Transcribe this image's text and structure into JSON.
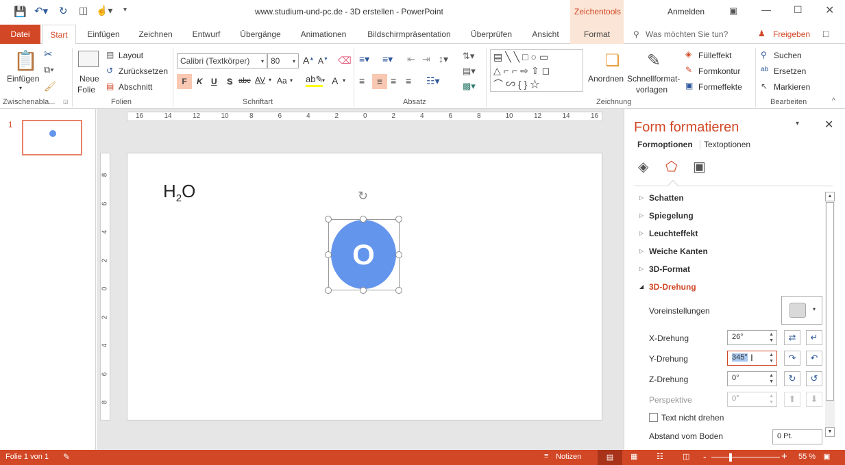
{
  "window": {
    "title": "www.studium-und-pc.de - 3D erstellen - PowerPoint",
    "context_tab": "Zeichentools",
    "signin": "Anmelden"
  },
  "tabs": [
    "Datei",
    "Start",
    "Einfügen",
    "Zeichnen",
    "Entwurf",
    "Übergänge",
    "Animationen",
    "Bildschirmpräsentation",
    "Überprüfen",
    "Ansicht",
    "Format"
  ],
  "tell_me": "Was möchten Sie tun?",
  "share": "Freigeben",
  "ribbon": {
    "clipboard": {
      "paste": "Einfügen",
      "group": "Zwischenabla..."
    },
    "slides": {
      "new_slide_1": "Neue",
      "new_slide_2": "Folie",
      "layout": "Layout",
      "reset": "Zurücksetzen",
      "section": "Abschnitt",
      "group": "Folien"
    },
    "font": {
      "name": "Calibri (Textkörper)",
      "size": "80",
      "bold": "F",
      "italic": "K",
      "underline": "U",
      "shadow": "S",
      "strike": "abc",
      "spacing": "AV",
      "case": "Aa",
      "group": "Schriftart"
    },
    "paragraph": {
      "group": "Absatz"
    },
    "drawing": {
      "arrange": "Anordnen",
      "quick_styles_1": "Schnellformat-",
      "quick_styles_2": "vorlagen",
      "fill": "Fülleffekt",
      "outline": "Formkontur",
      "effects": "Formeffekte",
      "group": "Zeichnung"
    },
    "editing": {
      "find": "Suchen",
      "replace": "Ersetzen",
      "select": "Markieren",
      "group": "Bearbeiten"
    }
  },
  "thumbnail": {
    "number": "1"
  },
  "ruler": {
    "h_ticks": [
      "16",
      "14",
      "12",
      "10",
      "8",
      "6",
      "4",
      "2",
      "0",
      "2",
      "4",
      "6",
      "8",
      "10",
      "12",
      "14",
      "16"
    ],
    "v_ticks": [
      "8",
      "6",
      "4",
      "2",
      "0",
      "2",
      "4",
      "6",
      "8"
    ]
  },
  "slide": {
    "formula_main": "H",
    "formula_sub": "2",
    "formula_end": "O",
    "shape_text": "O",
    "shape_color": "#6495ed"
  },
  "panel": {
    "title": "Form formatieren",
    "tab_shape": "Formoptionen",
    "tab_text": "Textoptionen",
    "sections": [
      "Schatten",
      "Spiegelung",
      "Leuchteffekt",
      "Weiche Kanten",
      "3D-Format"
    ],
    "open_section": "3D-Drehung",
    "presets": "Voreinstellungen",
    "x_label": "X-Drehung",
    "x_value": "26°",
    "y_label": "Y-Drehung",
    "y_value": "345°",
    "z_label": "Z-Drehung",
    "z_value": "0°",
    "persp_label": "Perspektive",
    "persp_value": "0°",
    "keep_text_flat": "Text nicht drehen",
    "keep_text_flat_checked": false,
    "distance_label": "Abstand vom Boden",
    "distance_value": "0 Pt."
  },
  "status": {
    "slide": "Folie 1 von 1",
    "notes": "Notizen",
    "zoom": "55 %",
    "zoom_percent": 55
  },
  "colors": {
    "accent": "#d24726",
    "shape": "#6495ed"
  }
}
